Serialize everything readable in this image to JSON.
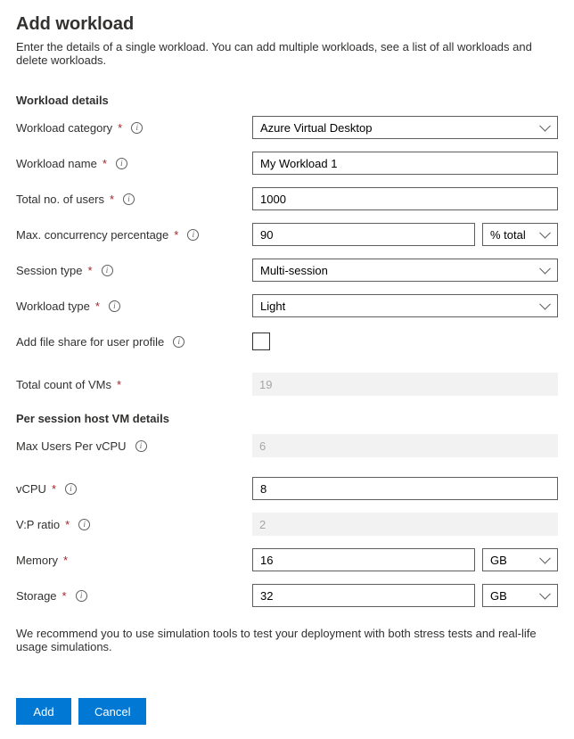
{
  "header": {
    "title": "Add workload",
    "subtitle": "Enter the details of a single workload. You can add multiple workloads, see a list of all workloads and delete workloads."
  },
  "sections": {
    "details_header": "Workload details",
    "vm_header": "Per session host VM details"
  },
  "fields": {
    "category_label": "Workload category",
    "category_value": "Azure Virtual Desktop",
    "name_label": "Workload name",
    "name_value": "My Workload 1",
    "users_label": "Total no. of users",
    "users_value": "1000",
    "conc_label": "Max. concurrency percentage",
    "conc_value": "90",
    "conc_unit": "% total",
    "session_label": "Session type",
    "session_value": "Multi-session",
    "wtype_label": "Workload type",
    "wtype_value": "Light",
    "fileshare_label": "Add file share for user profile",
    "vmcount_label": "Total count of VMs",
    "vmcount_value": "19",
    "maxusers_label": "Max Users Per vCPU",
    "maxusers_value": "6",
    "vcpu_label": "vCPU",
    "vcpu_value": "8",
    "vp_label": "V:P ratio",
    "vp_value": "2",
    "mem_label": "Memory",
    "mem_value": "16",
    "mem_unit": "GB",
    "storage_label": "Storage",
    "storage_value": "32",
    "storage_unit": "GB"
  },
  "footer": {
    "note": "We recommend you to use simulation tools to test your deployment with both stress tests and real-life usage simulations.",
    "add_label": "Add",
    "cancel_label": "Cancel"
  }
}
